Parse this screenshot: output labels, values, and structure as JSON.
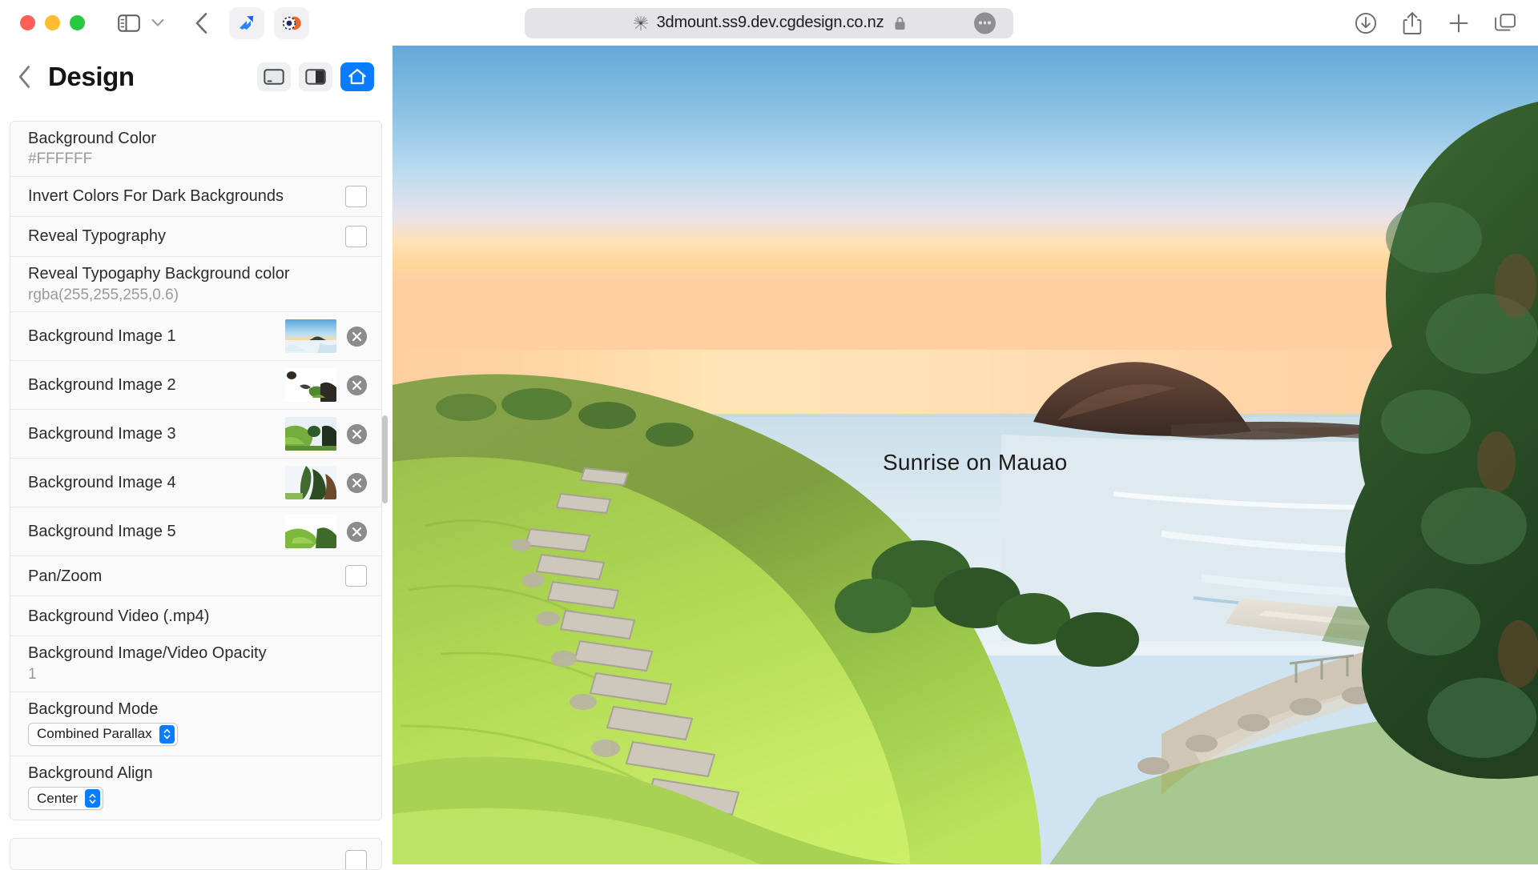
{
  "browser": {
    "url": "3dmount.ss9.dev.cgdesign.co.nz",
    "favicon_icon": "dandelion-icon",
    "lock_icon": "lock-icon",
    "more_icon": "more-ellipsis-icon",
    "traffic_lights": [
      "close-red",
      "minimize-yellow",
      "zoom-green"
    ],
    "left_controls": [
      {
        "name": "sidebar-toggle-button",
        "icon": "sidebar-icon"
      },
      {
        "name": "sidebar-menu-chevron",
        "icon": "chevron-down-icon"
      },
      {
        "name": "back-button",
        "icon": "chevron-left-icon"
      }
    ],
    "favorite_chips": [
      {
        "name": "favorite-chip-jira",
        "icon": "jira-icon"
      },
      {
        "name": "favorite-chip-app",
        "icon": "app-icon"
      }
    ],
    "right_controls": [
      {
        "name": "downloads-button",
        "icon": "download-circle-icon"
      },
      {
        "name": "share-button",
        "icon": "share-icon"
      },
      {
        "name": "new-tab-button",
        "icon": "plus-icon"
      },
      {
        "name": "tab-overview-button",
        "icon": "tabs-icon"
      }
    ]
  },
  "sidebar": {
    "back_icon": "chevron-left-icon",
    "title": "Design",
    "view_modes": [
      {
        "name": "view-mode-desktop",
        "icon": "desktop-view-icon",
        "active": false
      },
      {
        "name": "view-mode-split",
        "icon": "split-view-icon",
        "active": false
      },
      {
        "name": "view-mode-home",
        "icon": "home-icon",
        "active": true
      }
    ],
    "accent_color": "#0a7cff",
    "rows": [
      {
        "label": "Background Color",
        "value": "#FFFFFF",
        "type": "color"
      },
      {
        "label": "Invert Colors For Dark Backgrounds",
        "type": "checkbox",
        "checked": false
      },
      {
        "label": "Reveal Typography",
        "type": "checkbox",
        "checked": false
      },
      {
        "label": "Reveal Typogaphy Background color",
        "value": "rgba(255,255,255,0.6)",
        "type": "color"
      },
      {
        "label": "Background Image 1",
        "type": "image",
        "delete_icon": "delete-circle-icon"
      },
      {
        "label": "Background Image 2",
        "type": "image",
        "delete_icon": "delete-circle-icon"
      },
      {
        "label": "Background Image 3",
        "type": "image",
        "delete_icon": "delete-circle-icon"
      },
      {
        "label": "Background Image 4",
        "type": "image",
        "delete_icon": "delete-circle-icon"
      },
      {
        "label": "Background Image 5",
        "type": "image",
        "delete_icon": "delete-circle-icon"
      },
      {
        "label": "Pan/Zoom",
        "type": "checkbox",
        "checked": false
      },
      {
        "label": "Background Video (.mp4)",
        "type": "plain"
      },
      {
        "label": "Background Image/Video Opacity",
        "value": "1",
        "type": "number"
      },
      {
        "label": "Background Mode",
        "selected": "Combined Parallax",
        "type": "select"
      },
      {
        "label": "Background Align",
        "selected": "Center",
        "type": "select"
      }
    ],
    "extra_row": {
      "label": "",
      "type": "checkbox",
      "checked": false
    }
  },
  "preview": {
    "caption": "Sunrise on Mauao"
  }
}
